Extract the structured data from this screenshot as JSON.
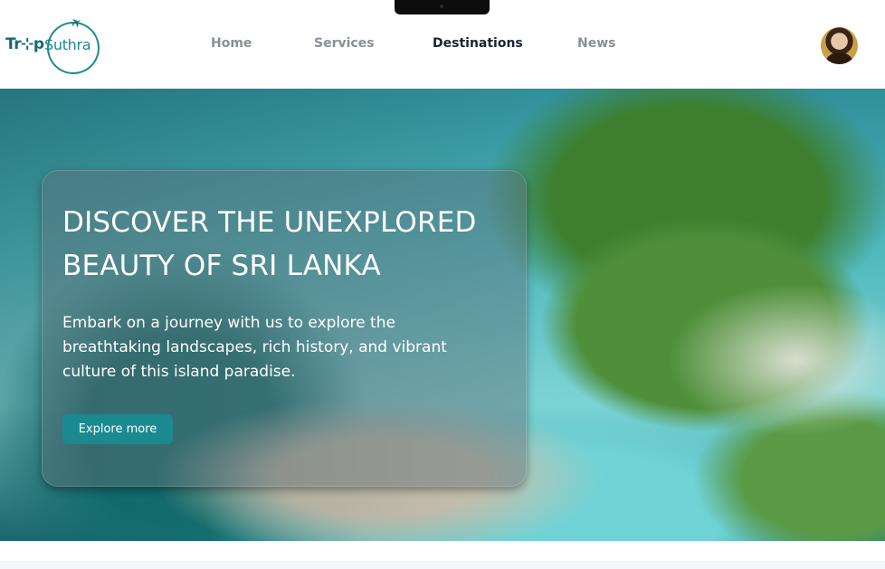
{
  "brand": {
    "logo_text_1": "Tr⊹p",
    "logo_text_2": "Suthra"
  },
  "nav": {
    "items": [
      {
        "label": "Home",
        "active": false
      },
      {
        "label": "Services",
        "active": false
      },
      {
        "label": "Destinations",
        "active": true
      },
      {
        "label": "News",
        "active": false
      }
    ]
  },
  "user": {
    "avatar_icon": "user-avatar"
  },
  "hero": {
    "title": "DISCOVER THE UNEXPLORED BEAUTY OF SRI LANKA",
    "description": "Embark on a journey with us to explore the breathtaking landscapes, rich history, and vibrant culture of this island paradise.",
    "cta_label": "Explore more"
  },
  "colors": {
    "accent": "#1a8a90",
    "nav_active": "#1d2430",
    "nav_inactive": "#8a8f96"
  }
}
